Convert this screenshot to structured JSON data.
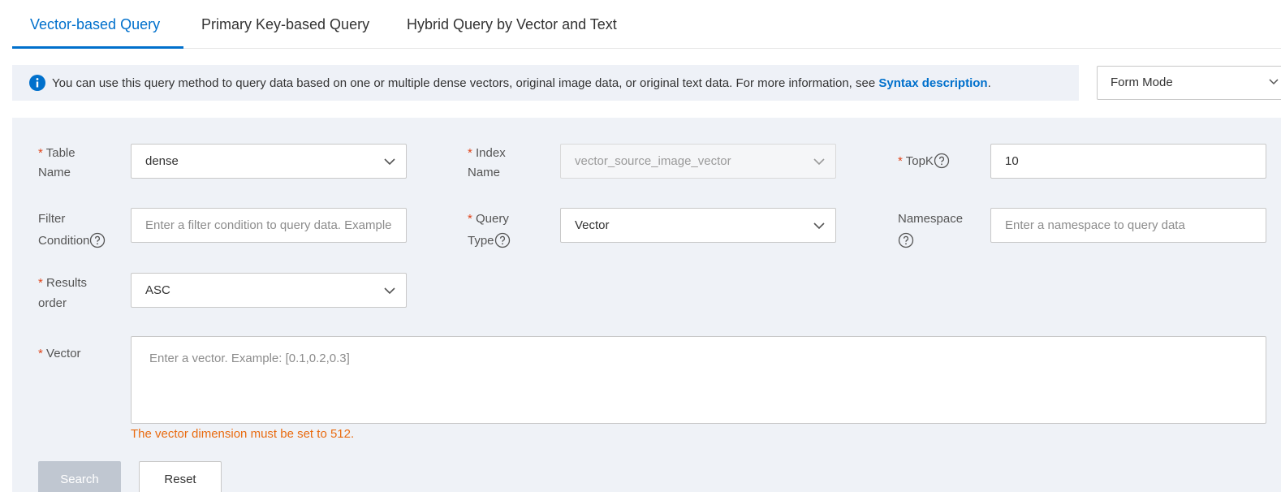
{
  "tabs": [
    {
      "label": "Vector-based Query",
      "active": true
    },
    {
      "label": "Primary Key-based Query",
      "active": false
    },
    {
      "label": "Hybrid Query by Vector and Text",
      "active": false
    }
  ],
  "info": {
    "text": "You can use this query method to query data based on one or multiple dense vectors, original image data, or original text data. For more information, see ",
    "link_text": "Syntax description",
    "trailing": "."
  },
  "mode_select": {
    "value": "Form Mode"
  },
  "form": {
    "required_mark": "*",
    "table_name": {
      "label_line1": "Table",
      "label_line2": "Name",
      "value": "dense"
    },
    "index_name": {
      "label_line1": "Index",
      "label_line2": "Name",
      "value": "vector_source_image_vector"
    },
    "topk": {
      "label": "TopK",
      "value": "10"
    },
    "filter_condition": {
      "label_line1": "Filter",
      "label_line2": "Condition",
      "placeholder": "Enter a filter condition to query data. Example"
    },
    "query_type": {
      "label_line1": "Query",
      "label_line2": "Type",
      "value": "Vector"
    },
    "namespace": {
      "label": "Namespace",
      "placeholder": "Enter a namespace to query data"
    },
    "results_order": {
      "label_line1": "Results",
      "label_line2": "order",
      "value": "ASC"
    },
    "vector": {
      "label": "Vector",
      "placeholder": "Enter a vector. Example: [0.1,0.2,0.3]",
      "error": "The vector dimension must be set to 512."
    }
  },
  "buttons": {
    "search": "Search",
    "reset": "Reset"
  },
  "colors": {
    "accent": "#0070cc",
    "required": "#e0451b",
    "error": "#e96b10",
    "panel_bg": "#eff2f7"
  }
}
